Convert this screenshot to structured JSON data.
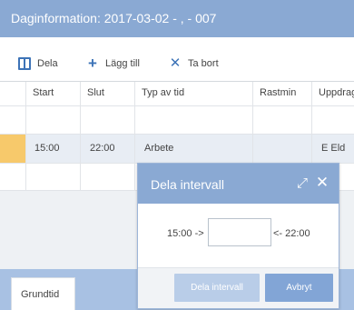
{
  "window": {
    "title": "Daginformation: 2017-03-02 - , - 007"
  },
  "toolbar": {
    "split_label": "Dela",
    "add_label": "Lägg till",
    "delete_label": "Ta bort"
  },
  "grid": {
    "columns": [
      "Start",
      "Slut",
      "Typ av tid",
      "Rastmin",
      "Uppdrag"
    ],
    "rows": [
      {
        "start": "15:00",
        "slut": "22:00",
        "typ": "Arbete",
        "rastmin": "",
        "uppdrag": "E Eld"
      }
    ]
  },
  "bottom": {
    "tab_label": "Grundtid"
  },
  "dialog": {
    "title": "Dela intervall",
    "from_label": "15:00 ->",
    "to_label": "<- 22:00",
    "input_value": "",
    "split_button": "Dela intervall",
    "cancel_button": "Avbryt"
  },
  "colors": {
    "header_blue": "#8aa9d3",
    "icon_blue": "#3d73b7",
    "row_marker": "#f7c96b",
    "selected_row": "#e8edf4"
  },
  "icons": [
    "split-view-icon",
    "plus-icon",
    "close-x-icon",
    "expand-icon",
    "close-icon"
  ]
}
